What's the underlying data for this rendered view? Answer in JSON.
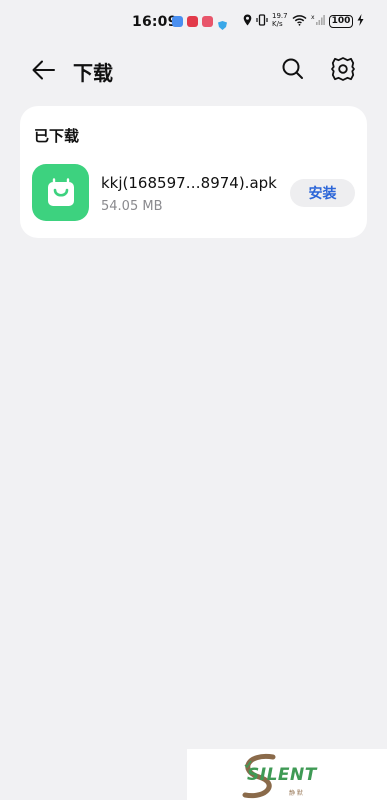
{
  "status_bar": {
    "time": "16:09",
    "network_speed_value": "19.7",
    "network_speed_unit": "K/s",
    "battery": "100"
  },
  "app_bar": {
    "title": "下载"
  },
  "downloads": {
    "section_title": "已下载",
    "items": [
      {
        "file_name": "kkj(168597…8974).apk",
        "size": "54.05 MB",
        "action_label": "安装",
        "icon": "shopping-bag-icon",
        "icon_color": "#3dd27f"
      }
    ]
  },
  "watermark": {
    "text": "SILENT",
    "subtext": "静 默"
  },
  "colors": {
    "background": "#f1f1f3",
    "card": "#ffffff",
    "accent": "#2c66d8"
  }
}
